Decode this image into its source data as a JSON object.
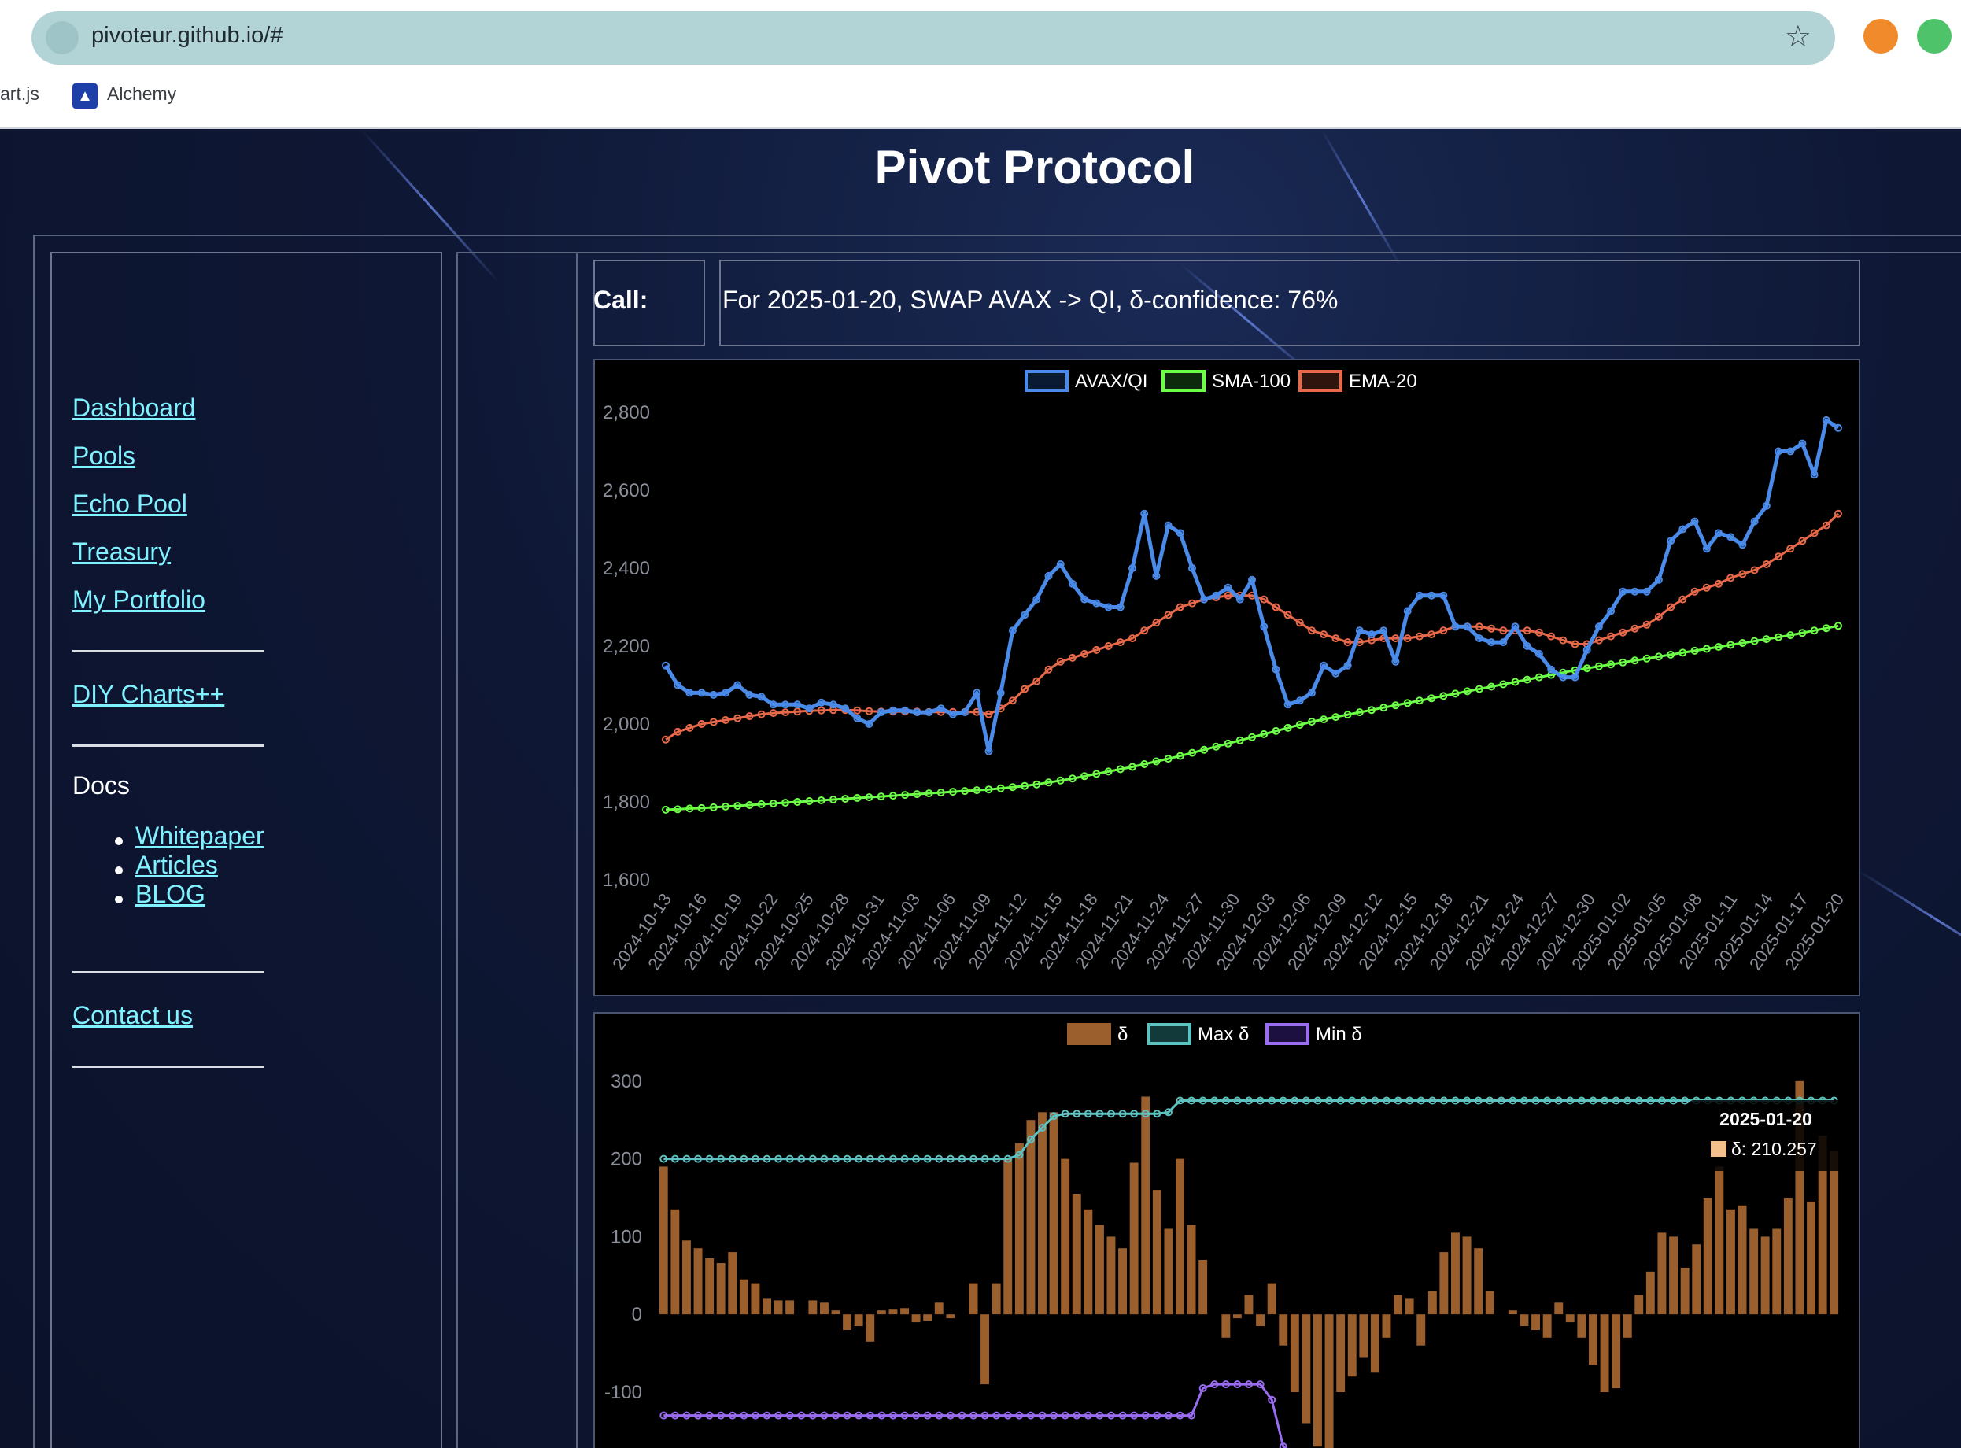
{
  "browser": {
    "url": "pivoteur.github.io/#",
    "bookmarks": [
      "art.js",
      "Alchemy"
    ]
  },
  "page": {
    "title": "Pivot Protocol"
  },
  "sidebar": {
    "nav": [
      "Dashboard",
      "Pools",
      "Echo Pool",
      "Treasury",
      "My Portfolio"
    ],
    "diy": "DIY Charts++",
    "docs_heading": "Docs",
    "docs": [
      "Whitepaper",
      "Articles",
      "BLOG"
    ],
    "contact": "Contact us"
  },
  "call": {
    "label": "Call:",
    "text": "For 2025-01-20, SWAP AVAX -> QI, δ-confidence: 76%"
  },
  "colors": {
    "avax": "#4a8ae8",
    "sma": "#6dff47",
    "ema": "#e8694a",
    "delta": "#9b5f2e",
    "maxdelta": "#5ec2c0",
    "mindelta": "#9a6cf0"
  },
  "chart_data": [
    {
      "type": "line",
      "legend": [
        "AVAX/QI",
        "SMA-100",
        "EMA-20"
      ],
      "legend_position": "top",
      "ylim": [
        1600,
        2800
      ],
      "yticks": [
        "2,800",
        "2,600",
        "2,400",
        "2,200",
        "2,000",
        "1,800",
        "1,600"
      ],
      "xticks": [
        "2024-10-13",
        "2024-10-16",
        "2024-10-19",
        "2024-10-22",
        "2024-10-25",
        "2024-10-28",
        "2024-10-31",
        "2024-11-03",
        "2024-11-06",
        "2024-11-09",
        "2024-11-12",
        "2024-11-15",
        "2024-11-18",
        "2024-11-21",
        "2024-11-24",
        "2024-11-27",
        "2024-11-30",
        "2024-12-03",
        "2024-12-06",
        "2024-12-09",
        "2024-12-12",
        "2024-12-15",
        "2024-12-18",
        "2024-12-21",
        "2024-12-24",
        "2024-12-27",
        "2024-12-30",
        "2025-01-02",
        "2025-01-05",
        "2025-01-08",
        "2025-01-11",
        "2025-01-14",
        "2025-01-17",
        "2025-01-20"
      ],
      "series": [
        {
          "name": "AVAX/QI",
          "values": [
            2150,
            2100,
            2080,
            2080,
            2075,
            2080,
            2100,
            2075,
            2070,
            2050,
            2050,
            2050,
            2040,
            2055,
            2050,
            2040,
            2015,
            2000,
            2030,
            2035,
            2035,
            2030,
            2030,
            2040,
            2025,
            2030,
            2080,
            1930,
            2080,
            2240,
            2280,
            2320,
            2380,
            2410,
            2360,
            2320,
            2310,
            2300,
            2300,
            2400,
            2540,
            2380,
            2510,
            2490,
            2400,
            2320,
            2330,
            2350,
            2320,
            2370,
            2250,
            2140,
            2050,
            2060,
            2080,
            2150,
            2130,
            2150,
            2240,
            2230,
            2240,
            2160,
            2290,
            2330,
            2330,
            2330,
            2250,
            2250,
            2220,
            2210,
            2210,
            2250,
            2200,
            2180,
            2140,
            2120,
            2120,
            2190,
            2250,
            2290,
            2340,
            2340,
            2340,
            2370,
            2470,
            2500,
            2520,
            2450,
            2490,
            2480,
            2460,
            2520,
            2560,
            2700,
            2700,
            2720,
            2640,
            2780,
            2760
          ]
        },
        {
          "name": "SMA-100",
          "values": [
            1780,
            1781,
            1783,
            1784,
            1786,
            1788,
            1790,
            1792,
            1794,
            1796,
            1798,
            1800,
            1802,
            1804,
            1806,
            1808,
            1810,
            1812,
            1814,
            1816,
            1818,
            1820,
            1822,
            1824,
            1826,
            1828,
            1830,
            1832,
            1835,
            1838,
            1841,
            1845,
            1850,
            1855,
            1860,
            1866,
            1872,
            1878,
            1884,
            1890,
            1897,
            1904,
            1911,
            1918,
            1926,
            1934,
            1942,
            1950,
            1958,
            1966,
            1974,
            1982,
            1990,
            1998,
            2006,
            2012,
            2018,
            2024,
            2030,
            2036,
            2042,
            2048,
            2054,
            2060,
            2066,
            2072,
            2078,
            2084,
            2090,
            2096,
            2102,
            2108,
            2114,
            2120,
            2126,
            2132,
            2138,
            2143,
            2148,
            2153,
            2158,
            2163,
            2168,
            2173,
            2178,
            2183,
            2188,
            2193,
            2198,
            2203,
            2208,
            2213,
            2218,
            2223,
            2228,
            2234,
            2240,
            2246,
            2252
          ]
        },
        {
          "name": "EMA-20",
          "values": [
            1960,
            1980,
            1990,
            2000,
            2005,
            2010,
            2015,
            2020,
            2025,
            2028,
            2030,
            2032,
            2034,
            2035,
            2036,
            2036,
            2035,
            2033,
            2032,
            2032,
            2032,
            2032,
            2031,
            2031,
            2031,
            2031,
            2031,
            2025,
            2040,
            2060,
            2090,
            2110,
            2140,
            2160,
            2170,
            2180,
            2190,
            2200,
            2210,
            2220,
            2240,
            2260,
            2280,
            2300,
            2310,
            2320,
            2325,
            2330,
            2330,
            2330,
            2320,
            2300,
            2280,
            2260,
            2240,
            2230,
            2220,
            2210,
            2210,
            2215,
            2220,
            2220,
            2220,
            2225,
            2230,
            2240,
            2250,
            2250,
            2250,
            2245,
            2240,
            2240,
            2240,
            2235,
            2225,
            2215,
            2205,
            2205,
            2215,
            2225,
            2235,
            2245,
            2255,
            2275,
            2300,
            2320,
            2340,
            2350,
            2360,
            2375,
            2385,
            2395,
            2410,
            2430,
            2450,
            2470,
            2490,
            2510,
            2540
          ]
        }
      ]
    },
    {
      "type": "bar",
      "legend": [
        "δ",
        "Max δ",
        "Min δ"
      ],
      "legend_position": "top",
      "ylim": [
        -180,
        320
      ],
      "yticks": [
        "300",
        "200",
        "100",
        "0",
        "-100"
      ],
      "tooltip": {
        "title": "2025-01-20",
        "text": "δ: 210.257"
      },
      "series": [
        {
          "name": "δ",
          "values": [
            190,
            135,
            95,
            85,
            72,
            66,
            80,
            45,
            40,
            20,
            18,
            18,
            0,
            18,
            15,
            5,
            -20,
            -15,
            -35,
            5,
            6,
            8,
            -10,
            -8,
            15,
            -5,
            0,
            40,
            -90,
            40,
            200,
            220,
            250,
            260,
            260,
            200,
            155,
            135,
            115,
            100,
            85,
            195,
            280,
            160,
            110,
            200,
            115,
            70,
            0,
            -30,
            -5,
            25,
            -15,
            40,
            -40,
            -100,
            -140,
            -170,
            -180,
            -100,
            -80,
            -55,
            -75,
            -30,
            25,
            20,
            -40,
            30,
            80,
            105,
            100,
            85,
            30,
            0,
            5,
            -15,
            -20,
            -30,
            15,
            -10,
            -30,
            -65,
            -100,
            -95,
            -30,
            25,
            55,
            105,
            100,
            60,
            90,
            150,
            190,
            135,
            140,
            110,
            100,
            110,
            150,
            300,
            145,
            230,
            210
          ]
        },
        {
          "name": "Max δ",
          "values": [
            200,
            200,
            200,
            200,
            200,
            200,
            200,
            200,
            200,
            200,
            200,
            200,
            200,
            200,
            200,
            200,
            200,
            200,
            200,
            200,
            200,
            200,
            200,
            200,
            200,
            200,
            200,
            200,
            200,
            200,
            200,
            205,
            225,
            240,
            255,
            258,
            258,
            258,
            258,
            258,
            258,
            258,
            258,
            258,
            260,
            275,
            275,
            275,
            275,
            275,
            275,
            275,
            275,
            275,
            275,
            275,
            275,
            275,
            275,
            275,
            275,
            275,
            275,
            275,
            275,
            275,
            275,
            275,
            275,
            275,
            275,
            275,
            275,
            275,
            275,
            275,
            275,
            275,
            275,
            275,
            275,
            275,
            275,
            275,
            275,
            275,
            275,
            275,
            275,
            275,
            275,
            275,
            275,
            275,
            275,
            275,
            275,
            275,
            275,
            275,
            275,
            275,
            275
          ]
        },
        {
          "name": "Min δ",
          "values": [
            -130,
            -130,
            -130,
            -130,
            -130,
            -130,
            -130,
            -130,
            -130,
            -130,
            -130,
            -130,
            -130,
            -130,
            -130,
            -130,
            -130,
            -130,
            -130,
            -130,
            -130,
            -130,
            -130,
            -130,
            -130,
            -130,
            -130,
            -130,
            -130,
            -130,
            -130,
            -130,
            -130,
            -130,
            -130,
            -130,
            -130,
            -130,
            -130,
            -130,
            -130,
            -130,
            -130,
            -130,
            -130,
            -130,
            -130,
            -95,
            -90,
            -90,
            -90,
            -90,
            -90,
            -110,
            -170,
            -180
          ]
        }
      ]
    }
  ]
}
